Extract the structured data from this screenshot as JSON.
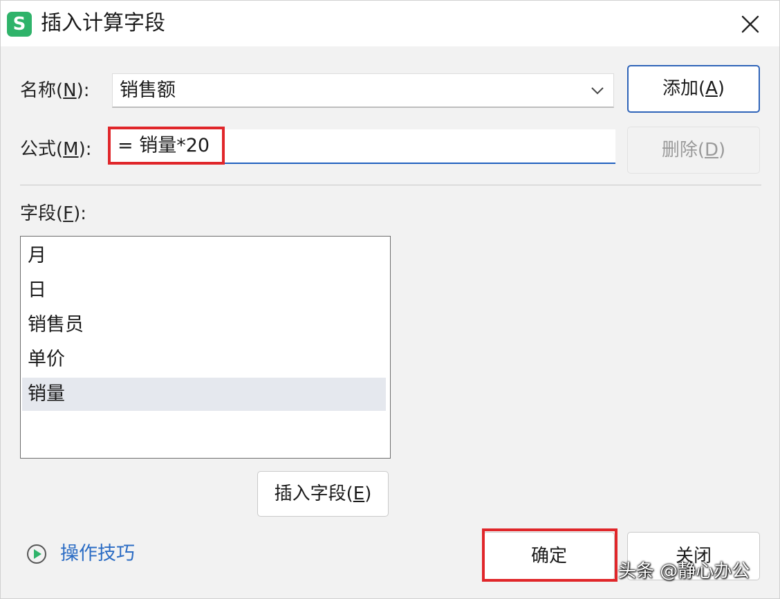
{
  "window": {
    "app_icon_letter": "S",
    "title": "插入计算字段"
  },
  "name_row": {
    "label_prefix": "名称(",
    "label_key": "N",
    "label_suffix": "):",
    "value": "销售额"
  },
  "formula_row": {
    "label_prefix": "公式(",
    "label_key": "M",
    "label_suffix": "):",
    "value": "= 销量*20"
  },
  "buttons": {
    "add": {
      "prefix": "添加(",
      "key": "A",
      "suffix": ")"
    },
    "delete": {
      "prefix": "删除(",
      "key": "D",
      "suffix": ")"
    },
    "insert_field": {
      "prefix": "插入字段(",
      "key": "E",
      "suffix": ")"
    },
    "ok": "确定",
    "close": "关闭"
  },
  "fields": {
    "label_prefix": "字段(",
    "label_key": "F",
    "label_suffix": "):",
    "items": [
      "月",
      "日",
      "销售员",
      "单价",
      "销量"
    ],
    "selected_index": 4
  },
  "tips": {
    "text": "操作技巧"
  },
  "watermark": "头条 @静心办公",
  "colors": {
    "accent": "#2e63b8",
    "highlight": "#e0262a",
    "app_icon": "#2fb36a",
    "link": "#2b6cc4"
  }
}
